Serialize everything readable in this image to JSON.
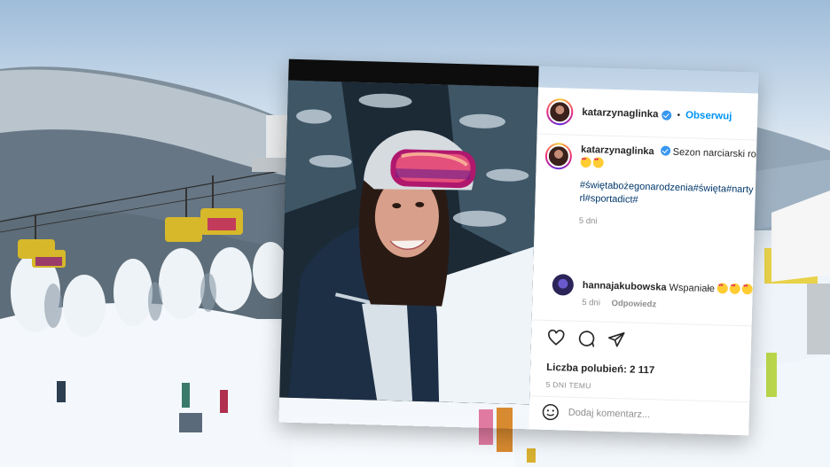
{
  "post": {
    "username": "katarzynaglinka",
    "follow_label": "Obserwuj",
    "separator": "•",
    "caption_text": "Sezon narciarski rozp",
    "hashtags": "#świętabożegonarodzenia#święta#narty girl#sportadict#",
    "caption_age": "5 dni",
    "likes_label": "Liczba polubień: 2 117",
    "date_label": "5 DNI TEMU",
    "add_comment_placeholder": "Dodaj komentarz..."
  },
  "comment": {
    "username": "hannajakubowska",
    "text": "Wspaniałe",
    "age": "5 dni",
    "reply_label": "Odpowiedz"
  },
  "icons": {
    "like": "heart-icon",
    "comment": "comment-icon",
    "share": "share-icon",
    "emoji": "emoji-icon",
    "verified": "verified-badge-icon"
  },
  "colors": {
    "link": "#0095f6",
    "hashtag": "#00376b",
    "text": "#262626",
    "muted": "#8e8e8e"
  }
}
